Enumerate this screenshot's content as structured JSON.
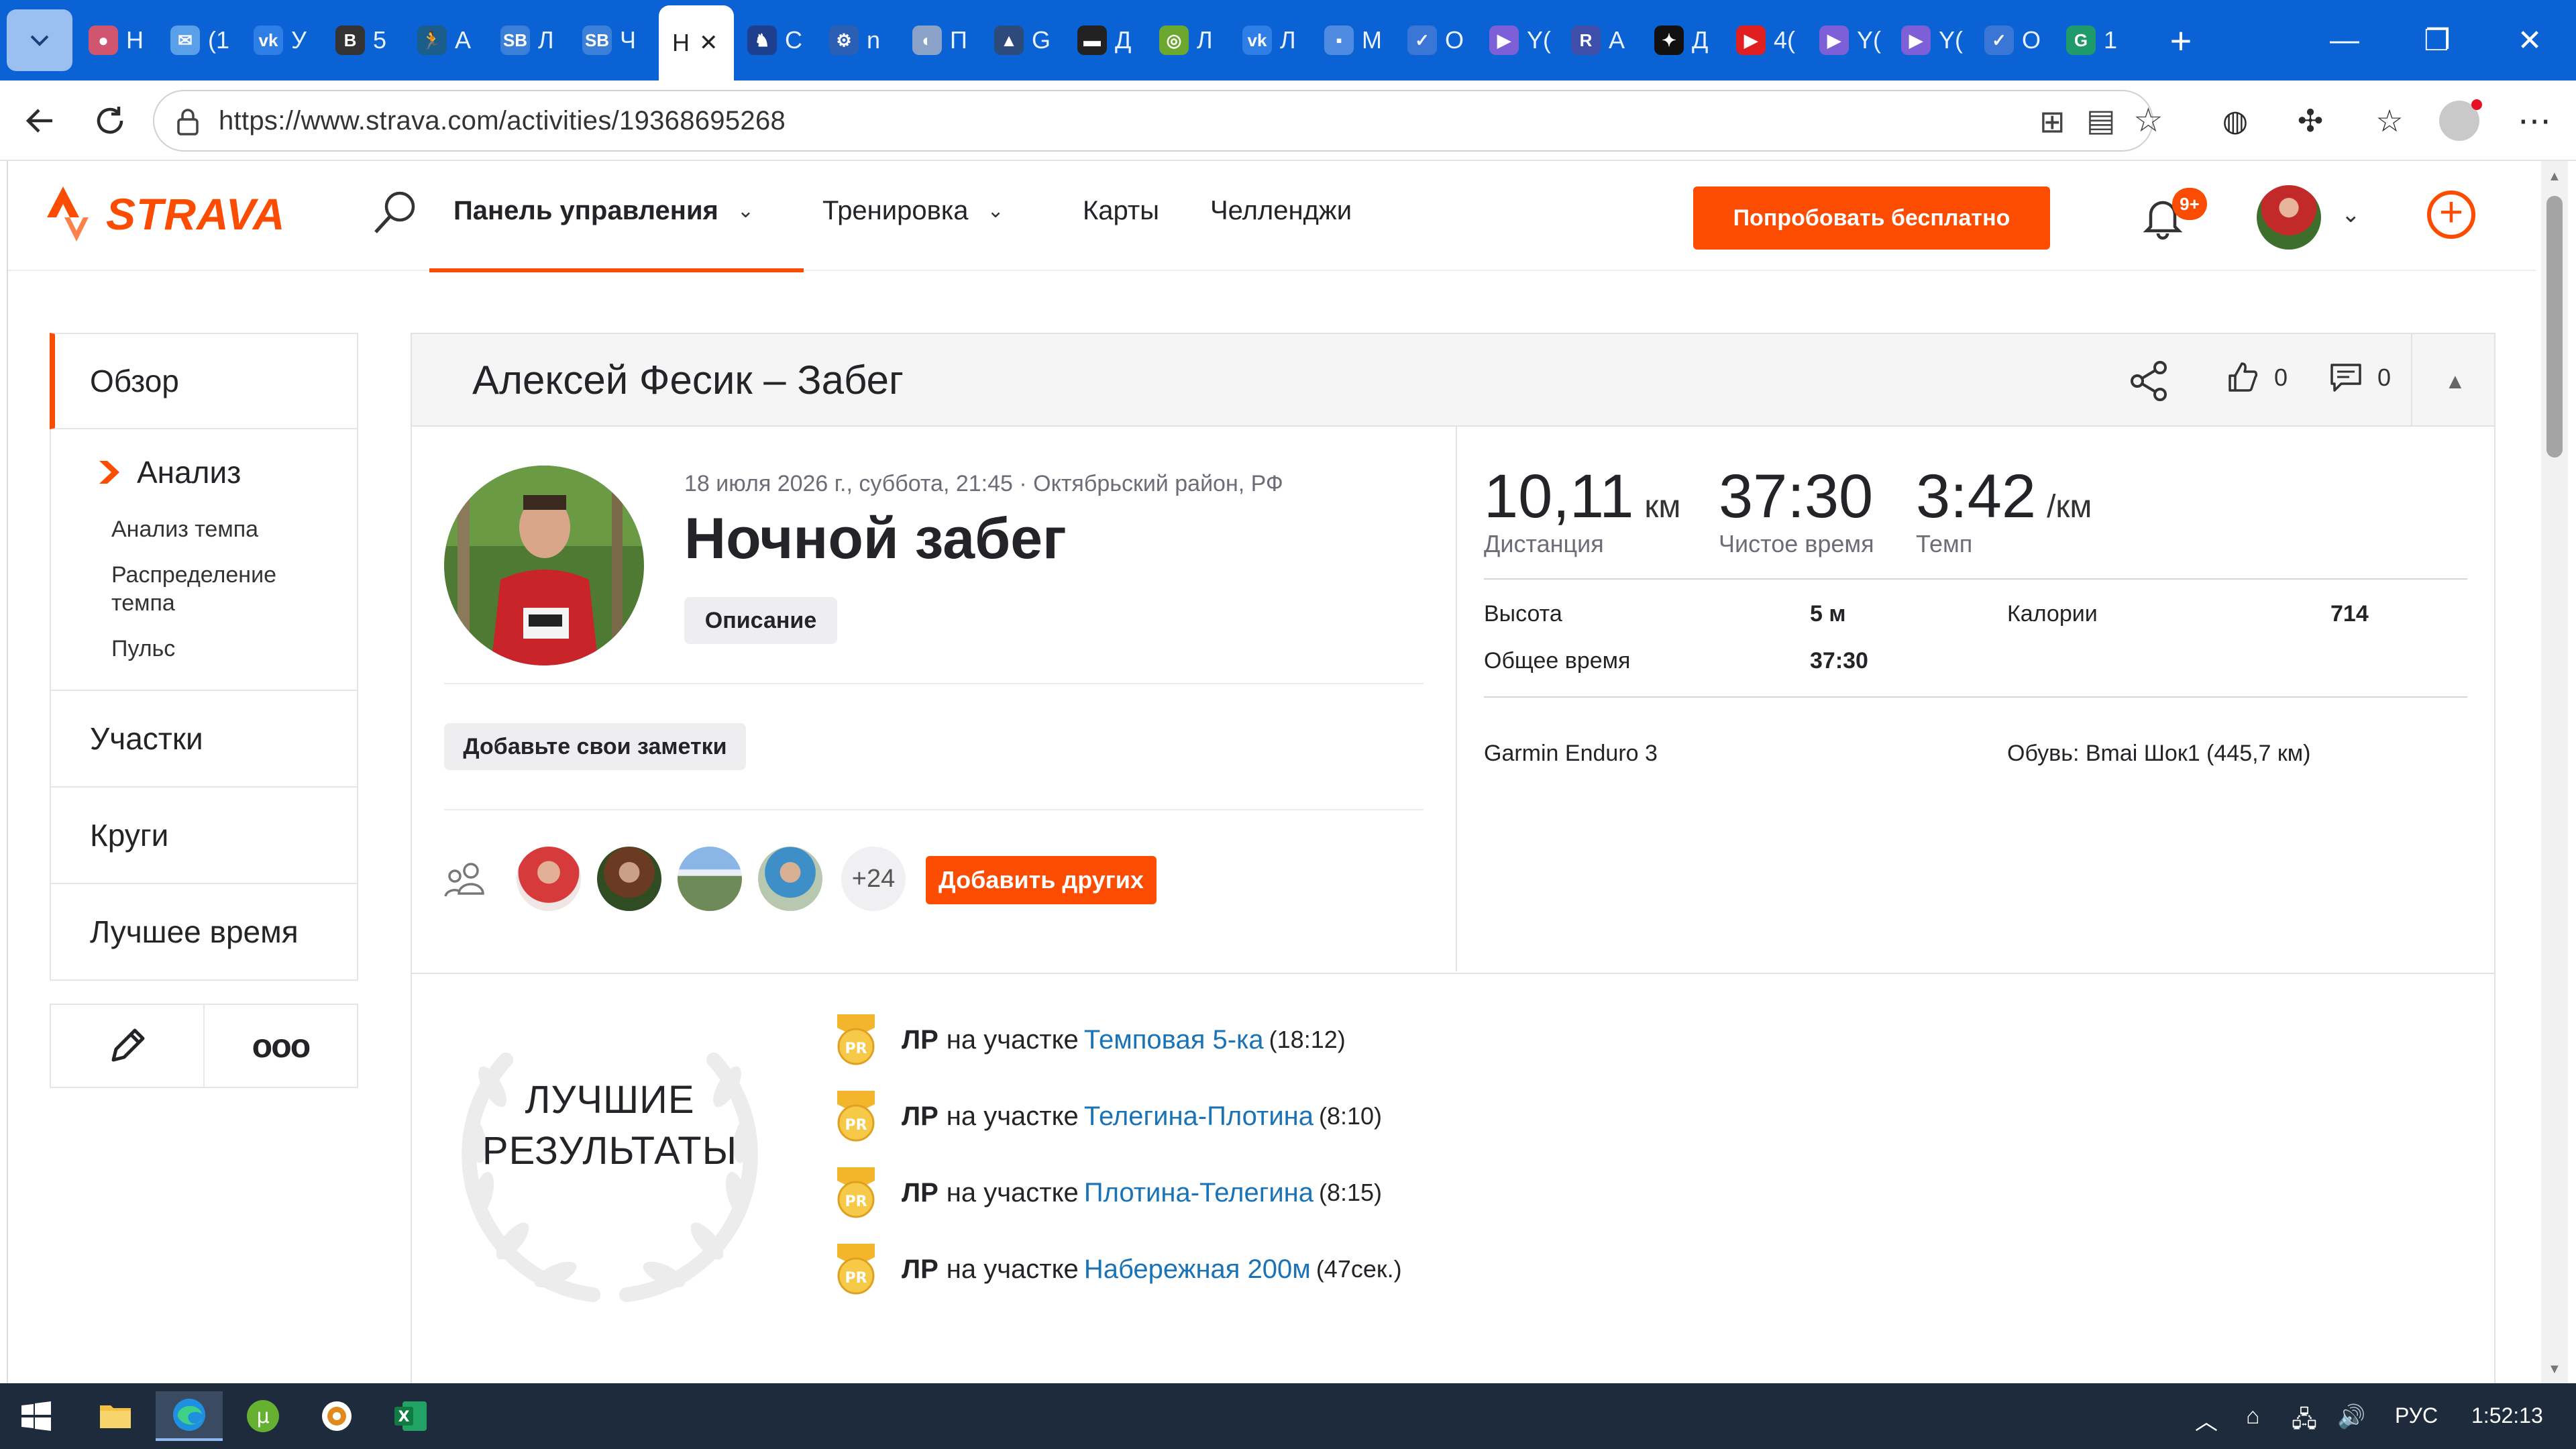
{
  "browser": {
    "tabs": [
      {
        "short": "Н",
        "color": "#d0556f",
        "glyph": "●"
      },
      {
        "short": "(1",
        "color": "#5aa0e8",
        "glyph": "✉"
      },
      {
        "short": "У",
        "color": "#2f7ee6",
        "glyph": "vk"
      },
      {
        "short": "5",
        "color": "#333",
        "glyph": "B"
      },
      {
        "short": "А",
        "color": "#1b5e8c",
        "glyph": "🏃"
      },
      {
        "short": "Л",
        "color": "#3c7fd8",
        "glyph": "SB"
      },
      {
        "short": "Ч",
        "color": "#3c7fd8",
        "glyph": "SB"
      },
      {
        "short": "С",
        "color": "#1d3f8e",
        "glyph": "♞"
      },
      {
        "short": "n",
        "color": "#2b5fb4",
        "glyph": "⚙"
      },
      {
        "short": "П",
        "color": "#8aa2c8",
        "glyph": "◐"
      },
      {
        "short": "G",
        "color": "#2c4a7a",
        "glyph": "▲"
      },
      {
        "short": "Д",
        "color": "#222",
        "glyph": "▬"
      },
      {
        "short": "Л",
        "color": "#6ca830",
        "glyph": "◎"
      },
      {
        "short": "Л",
        "color": "#2f7ee6",
        "glyph": "vk"
      },
      {
        "short": "М",
        "color": "#4f8be0",
        "glyph": "▪"
      },
      {
        "short": "О",
        "color": "#3a76d6",
        "glyph": "✓"
      },
      {
        "short": "Y(",
        "color": "#7d5fd8",
        "glyph": "▶"
      },
      {
        "short": "А",
        "color": "#3d4fa8",
        "glyph": "R"
      },
      {
        "short": "Д",
        "color": "#111",
        "glyph": "✦"
      },
      {
        "short": "4(",
        "color": "#e02020",
        "glyph": "▶"
      },
      {
        "short": "Y(",
        "color": "#7d5fd8",
        "glyph": "▶"
      },
      {
        "short": "Y(",
        "color": "#7d5fd8",
        "glyph": "▶"
      },
      {
        "short": "О",
        "color": "#3a76d6",
        "glyph": "✓"
      },
      {
        "short": "1",
        "color": "#1f9a6b",
        "glyph": "G"
      }
    ],
    "active_tab": {
      "title": "Н",
      "close": "✕"
    },
    "new_tab": "+",
    "window": {
      "minimize": "—",
      "restore": "❐",
      "close": "✕"
    },
    "url": "https://www.strava.com/activities/19368695268"
  },
  "strava": {
    "logo": "STRAVA",
    "nav": {
      "dashboard": "Панель управления",
      "training": "Тренировка",
      "maps": "Карты",
      "challenges": "Челленджи"
    },
    "try_free": "Попробовать бесплатно",
    "notif_badge": "9+"
  },
  "sidebar": {
    "overview": "Обзор",
    "analysis": "Анализ",
    "analysis_links": [
      "Анализ темпа",
      "Распределение темпа",
      "Пульс"
    ],
    "segments": "Участки",
    "laps": "Круги",
    "best_efforts": "Лучшее время",
    "more": "ooo"
  },
  "activity": {
    "header_title": "Алексей Фесик – Забег",
    "kudos": "0",
    "comments": "0",
    "meta": "18 июля 2026 г., суббота, 21:45 · Октябрьский район, РФ",
    "name": "Ночной забег",
    "description_btn": "Описание",
    "notes_btn": "Добавьте свои заметки",
    "more_athletes": "+24",
    "add_others": "Добавить других",
    "stats": {
      "distance": {
        "value": "10,11",
        "unit": "км",
        "label": "Дистанция"
      },
      "moving_time": {
        "value": "37:30",
        "label": "Чистое время"
      },
      "pace": {
        "value": "3:42",
        "unit": "/км",
        "label": "Темп"
      }
    },
    "details": {
      "elevation_label": "Высота",
      "elevation": "5 м",
      "calories_label": "Калории",
      "calories": "714",
      "elapsed_label": "Общее время",
      "elapsed": "37:30"
    },
    "device": "Garmin Enduro 3",
    "shoes": "Обувь: Bmai Шок1 (445,7 км)"
  },
  "achievements": {
    "title_line1": "ЛУЧШИЕ",
    "title_line2": "РЕЗУЛЬТАТЫ",
    "pr_label": "ЛР",
    "on_segment": "на участке",
    "rows": [
      {
        "segment": "Темповая 5-ка",
        "time": "(18:12)"
      },
      {
        "segment": "Телегина-Плотина",
        "time": "(8:10)"
      },
      {
        "segment": "Плотина-Телегина",
        "time": "(8:15)"
      },
      {
        "segment": "Набережная 200м",
        "time": "(47сек.)"
      }
    ]
  },
  "taskbar": {
    "lang": "РУС",
    "time": "1:52:13"
  },
  "colors": {
    "brand": "#fc4c02",
    "link": "#1a73b6",
    "browser_chrome": "#0a62d4",
    "taskbar": "#1e2b3c"
  }
}
